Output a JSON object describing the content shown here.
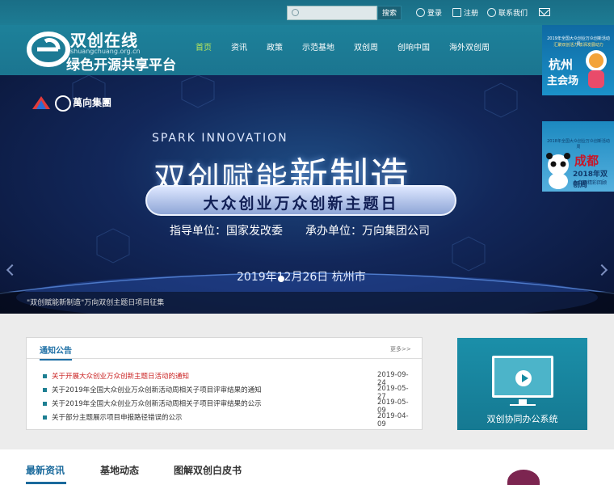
{
  "topbar": {
    "search_placeholder": "",
    "search_button": "搜索",
    "login": "登录",
    "register": "注册",
    "contact": "联系我们"
  },
  "header": {
    "logo_title": "双创在线",
    "logo_url": "shuangchuang.org.cn",
    "logo_subtitle": "绿色开源共享平台",
    "nav": [
      "首页",
      "资讯",
      "政策",
      "示范基地",
      "双创周",
      "创响中国",
      "海外双创周"
    ],
    "active_nav": 0
  },
  "side_ads": [
    {
      "small": "2019年全国大众创业万众创新活动周",
      "line2": "汇聚双创活力 澎湃发展动力",
      "city": "杭州",
      "venue": "主会场"
    },
    {
      "small": "2018年全国大众创业万众创新活动周",
      "city": "成都",
      "year_line": "2018年双创周",
      "venue": "主会场精彩回顾"
    }
  ],
  "banner": {
    "brand": "萬向集團",
    "spark": "SPARK INNOVATION",
    "title_a": "双创赋能",
    "title_b": "新制造",
    "pill": "大众创业万众创新主题日",
    "units": "指导单位：国家发改委　　承办单位：万向集团公司",
    "date": "2019年12月26日 杭州市",
    "caption": "\"双创赋能新制造\"万向双创主题日项目征集"
  },
  "notice": {
    "title": "通知公告",
    "more": "更多>>",
    "items": [
      {
        "text": "关于开展大众创业万众创新主题日活动的通知",
        "date": "2019-09-24",
        "hot": true
      },
      {
        "text": "关于2019年全国大众创业万众创新活动周相关子项目评审结果的通知",
        "date": "2019-05-27",
        "hot": false
      },
      {
        "text": "关于2019年全国大众创业万众创新活动周相关子项目评审结果的公示",
        "date": "2019-05-09",
        "hot": false
      },
      {
        "text": "关于部分主题展示项目申报路径错误的公示",
        "date": "2019-04-09",
        "hot": false
      }
    ]
  },
  "oa": {
    "label": "双创协同办公系统"
  },
  "tabs": [
    "最新资讯",
    "基地动态",
    "图解双创白皮书"
  ],
  "colors": {
    "teal": "#1b7590",
    "accent_green": "#b9e85a",
    "notice_blue": "#1d6fa5",
    "hot_red": "#c91e1e"
  }
}
